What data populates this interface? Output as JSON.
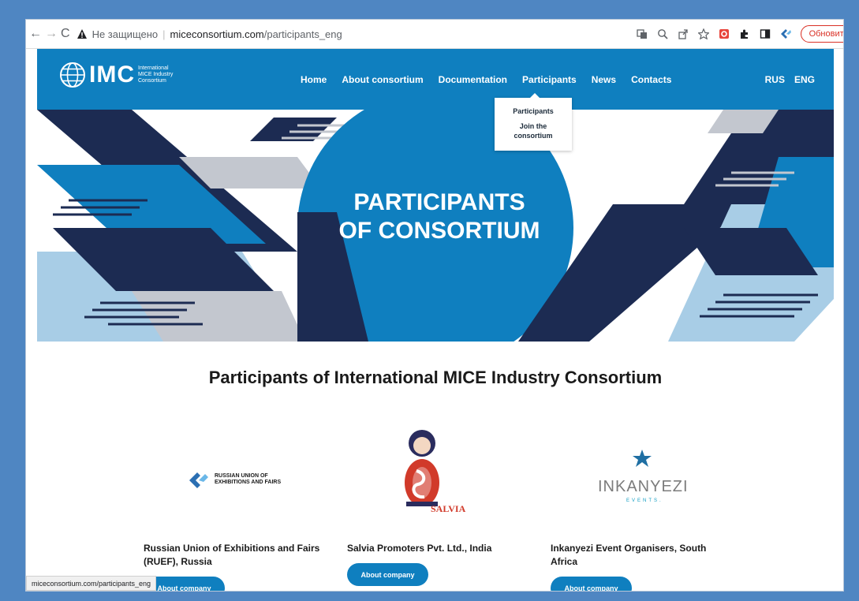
{
  "browser": {
    "back": "←",
    "forward": "→",
    "reload": "C",
    "insecure_label": "Не защищено",
    "url_host": "miceconsortium.com",
    "url_path": "/participants_eng",
    "update_label": "Обновить",
    "menu": "⋮"
  },
  "site": {
    "logo_mark": "IMC",
    "logo_sub_1": "International",
    "logo_sub_2": "MICE Industry",
    "logo_sub_3": "Consortium",
    "nav": [
      "Home",
      "About consortium",
      "Documentation",
      "Participants",
      "News",
      "Contacts"
    ],
    "lang": [
      "RUS",
      "ENG"
    ],
    "dropdown": [
      "Participants",
      "Join the consortium"
    ]
  },
  "hero": {
    "line1": "PARTICIPANTS",
    "line2": "OF CONSORTIUM"
  },
  "content": {
    "title": "Participants of International MICE Industry Consortium",
    "cards": [
      {
        "name": "Russian Union of Exhibitions and Fairs (RUEF), Russia",
        "button": "About company",
        "logo_text_1": "RUSSIAN UNION OF",
        "logo_text_2": "EXHIBITIONS AND FAIRS"
      },
      {
        "name": "Salvia Promoters Pvt. Ltd., India",
        "button": "About company",
        "logo_text_1": "SALVIA"
      },
      {
        "name": "Inkanyezi Event Organisers, South Africa",
        "button": "About company",
        "logo_text_1": "INKANYEZI",
        "logo_text_2": "EVENTS."
      }
    ]
  },
  "status_url": "miceconsortium.com/participants_eng",
  "colors": {
    "brand": "#0f7fbf",
    "navy": "#1c2b52",
    "frame": "#4f86c2"
  }
}
